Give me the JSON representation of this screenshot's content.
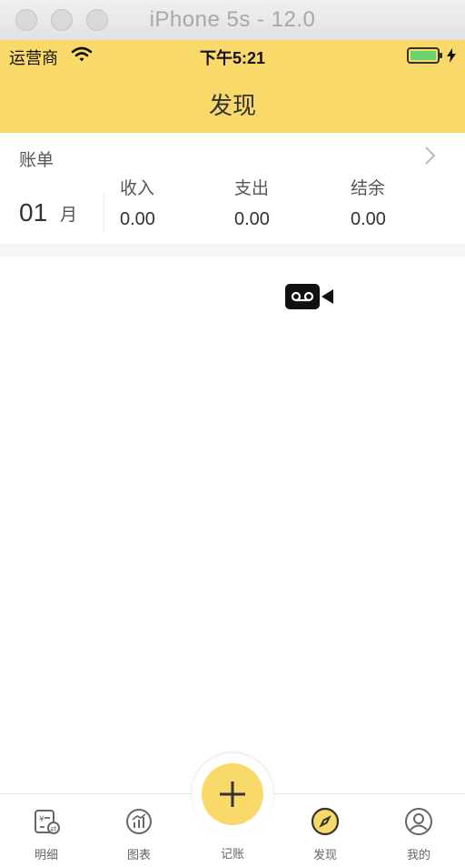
{
  "window": {
    "title": "iPhone 5s - 12.0"
  },
  "status_bar": {
    "carrier": "运营商",
    "time": "下午5:21"
  },
  "nav": {
    "title": "发现"
  },
  "bill": {
    "title": "账单",
    "month": "01",
    "month_unit": "月",
    "columns": [
      {
        "label": "收入",
        "value": "0.00"
      },
      {
        "label": "支出",
        "value": "0.00"
      },
      {
        "label": "结余",
        "value": "0.00"
      }
    ]
  },
  "tabbar": {
    "items": [
      {
        "label": "明细",
        "icon": "detail-icon"
      },
      {
        "label": "图表",
        "icon": "chart-icon"
      },
      {
        "label": "记账",
        "icon": "plus-icon"
      },
      {
        "label": "发现",
        "icon": "compass-icon"
      },
      {
        "label": "我的",
        "icon": "profile-icon"
      }
    ]
  },
  "colors": {
    "accent": "#f9d96a",
    "text": "#333333",
    "muted": "#666666"
  }
}
